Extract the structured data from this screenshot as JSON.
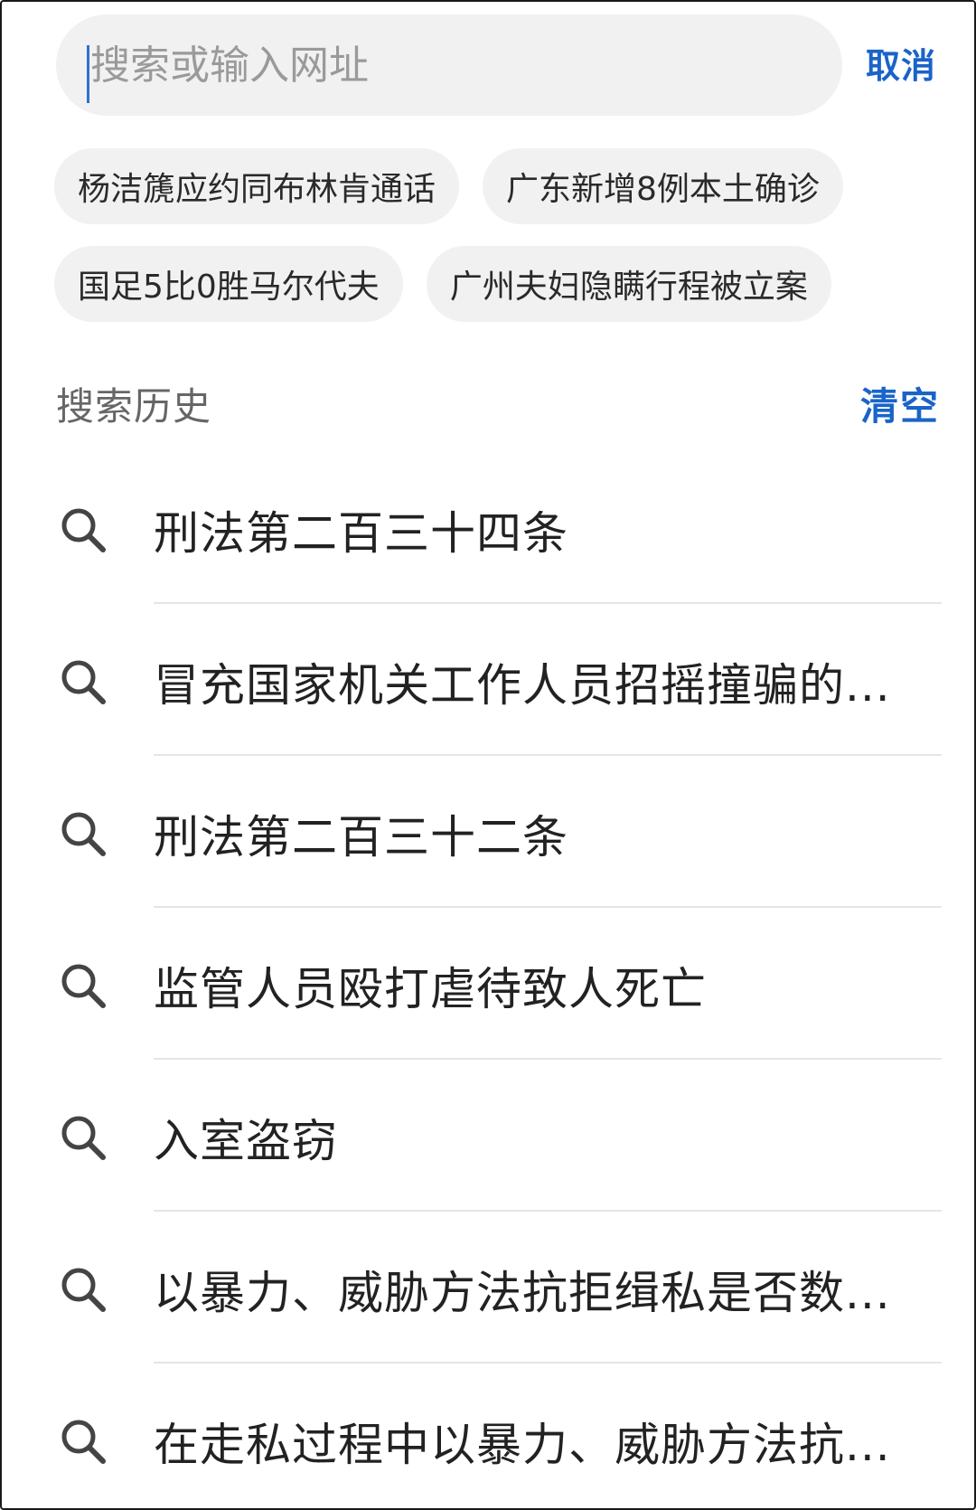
{
  "search": {
    "placeholder": "搜索或输入网址",
    "value": "",
    "cancel_label": "取消"
  },
  "hot_searches": [
    "杨洁篪应约同布林肯通话",
    "广东新增8例本土确诊",
    "国足5比0胜马尔代夫",
    "广州夫妇隐瞒行程被立案"
  ],
  "history": {
    "title": "搜索历史",
    "clear_label": "清空",
    "items": [
      "刑法第二百三十四条",
      "冒充国家机关工作人员招摇撞骗的...",
      "刑法第二百三十二条",
      "监管人员殴打虐待致人死亡",
      "入室盗窃",
      "以暴力、威胁方法抗拒缉私是否数...",
      "在走私过程中以暴力、威胁方法抗..."
    ]
  },
  "icons": {
    "history_item": "search-icon"
  },
  "colors": {
    "accent": "#1a64c8",
    "chip_bg": "#f1f1f1",
    "caret": "#2f6fd6"
  }
}
